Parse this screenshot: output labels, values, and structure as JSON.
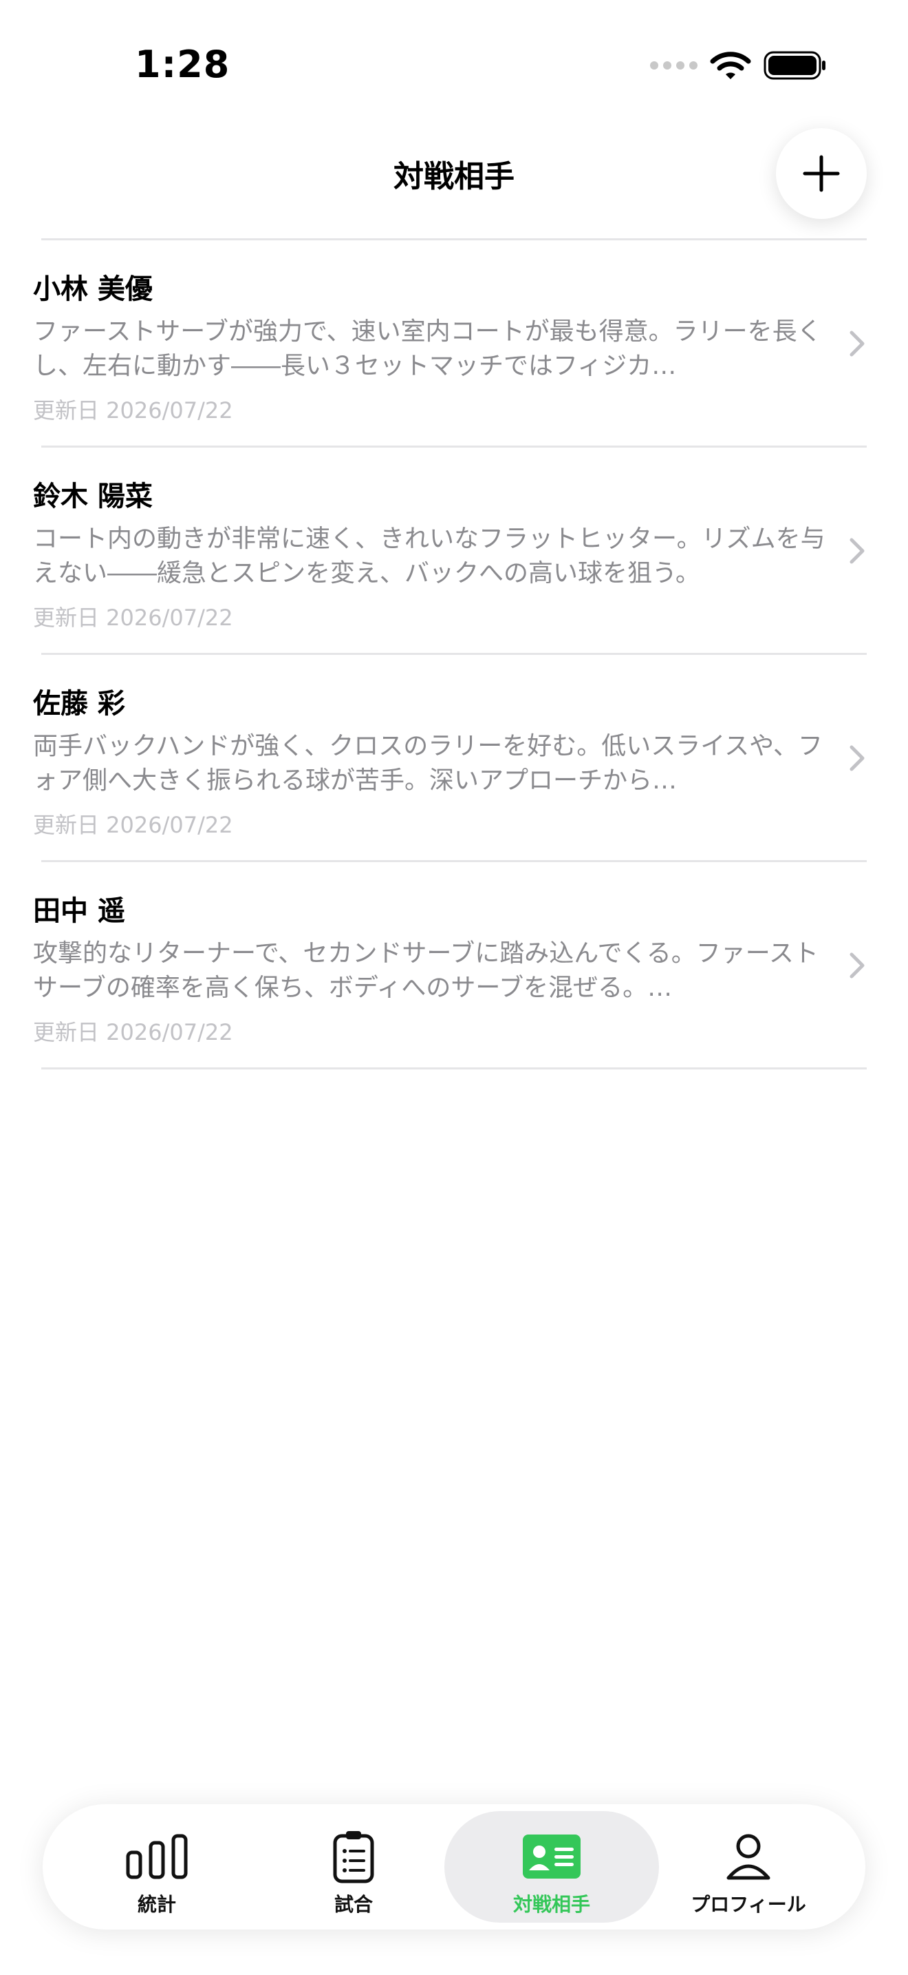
{
  "status": {
    "time": "1:28",
    "icons": [
      "cellular-signal-icon",
      "wifi-icon",
      "battery-icon"
    ]
  },
  "header": {
    "title": "対戦相手",
    "add_icon": "plus-icon"
  },
  "opponents": [
    {
      "name": "小林 美優",
      "description": "ファーストサーブが強力で、速い室内コートが最も得意。ラリーを長くし、左右に動かす――長い３セットマッチではフィジカ…",
      "updated": "更新日 2026/07/22"
    },
    {
      "name": "鈴木 陽菜",
      "description": "コート内の動きが非常に速く、きれいなフラットヒッター。リズムを与えない――緩急とスピンを変え、バックへの高い球を狙う。",
      "updated": "更新日 2026/07/22"
    },
    {
      "name": "佐藤 彩",
      "description": "両手バックハンドが強く、クロスのラリーを好む。低いスライスや、フォア側へ大きく振られる球が苦手。深いアプローチから…",
      "updated": "更新日 2026/07/22"
    },
    {
      "name": "田中 遥",
      "description": "攻撃的なリターナーで、セカンドサーブに踏み込んでくる。ファーストサーブの確率を高く保ち、ボディへのサーブを混ぜる。…",
      "updated": "更新日 2026/07/22"
    }
  ],
  "tabs": [
    {
      "label": "統計",
      "icon": "bar-chart-icon",
      "active": false
    },
    {
      "label": "試合",
      "icon": "clipboard-icon",
      "active": false
    },
    {
      "label": "対戦相手",
      "icon": "contact-card-icon",
      "active": true
    },
    {
      "label": "プロフィール",
      "icon": "person-icon",
      "active": false
    }
  ],
  "colors": {
    "accent": "#34c759",
    "secondary_text": "#8a8a8e",
    "tertiary_text": "#c2c2c6",
    "divider": "#e5e5e7",
    "active_tab_bg": "#ececee"
  }
}
